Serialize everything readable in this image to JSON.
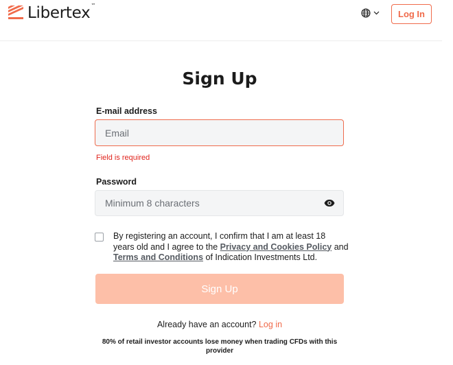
{
  "header": {
    "logo_text": "Libertex",
    "logo_tm": "™",
    "login_label": "Log In",
    "brand_color": "#f06a4a"
  },
  "form": {
    "title": "Sign Up",
    "email_label": "E-mail address",
    "email_placeholder": "Email",
    "email_error": "Field is required",
    "password_label": "Password",
    "password_placeholder": "Minimum 8 characters",
    "consent_prefix": "By registering an account, I confirm that I am at least 18 years old and I agree to the ",
    "privacy_link": "Privacy and Cookies Policy",
    "consent_and": " and ",
    "terms_link": "Terms and Conditions",
    "consent_suffix": " of Indication Investments Ltd.",
    "submit_label": "Sign Up",
    "already_text": "Already have an account? ",
    "login_link": "Log in",
    "risk_warning": "80% of retail investor accounts lose money when trading CFDs with this provider"
  },
  "colors": {
    "accent": "#f06a4a",
    "error": "#e0231c",
    "submit_disabled": "#fdbfa8"
  }
}
